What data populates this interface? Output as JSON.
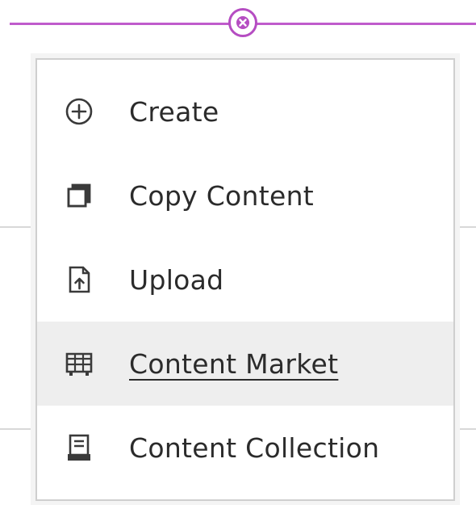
{
  "colors": {
    "accent": "#c05ccc",
    "close_border": "#b54dc2",
    "highlight": "#eeeeee",
    "text": "#2b2b2b",
    "icon": "#3a3a3a"
  },
  "close_button": {
    "icon": "close-icon"
  },
  "menu": {
    "items": [
      {
        "label": "Create",
        "icon": "plus-circle-icon",
        "highlighted": false
      },
      {
        "label": "Copy Content",
        "icon": "copy-icon",
        "highlighted": false
      },
      {
        "label": "Upload",
        "icon": "upload-file-icon",
        "highlighted": false
      },
      {
        "label": "Content Market",
        "icon": "market-icon",
        "highlighted": true
      },
      {
        "label": "Content Collection",
        "icon": "collection-icon",
        "highlighted": false
      }
    ]
  }
}
